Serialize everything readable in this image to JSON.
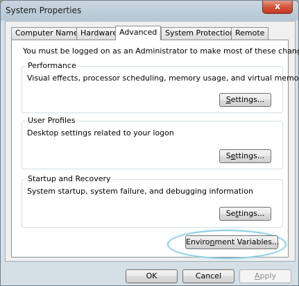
{
  "window": {
    "title": "System Properties",
    "close_glyph": "x"
  },
  "tabs": [
    {
      "label": "Computer Name"
    },
    {
      "label": "Hardware"
    },
    {
      "label": "Advanced",
      "active": true
    },
    {
      "label": "System Protection"
    },
    {
      "label": "Remote"
    }
  ],
  "admin_notice": "You must be logged on as an Administrator to make most of these changes.",
  "groups": {
    "performance": {
      "title": "Performance",
      "description": "Visual effects, processor scheduling, memory usage, and virtual memory",
      "button": {
        "pre": "",
        "accel": "S",
        "post": "ettings..."
      }
    },
    "user_profiles": {
      "title": "User Profiles",
      "description": "Desktop settings related to your logon",
      "button": {
        "pre": "S",
        "accel": "e",
        "post": "ttings..."
      }
    },
    "startup_recovery": {
      "title": "Startup and Recovery",
      "description": "System startup, system failure, and debugging information",
      "button": {
        "pre": "Se",
        "accel": "t",
        "post": "tings..."
      }
    }
  },
  "env_button": {
    "pre": "Enviro",
    "accel": "n",
    "post": "ment Variables..."
  },
  "footer": {
    "ok": "OK",
    "cancel": "Cancel",
    "apply": {
      "pre": "",
      "accel": "A",
      "post": "pply"
    }
  },
  "colors": {
    "highlight_ring": "#8fcfe0",
    "close_button": "#d4533b"
  }
}
